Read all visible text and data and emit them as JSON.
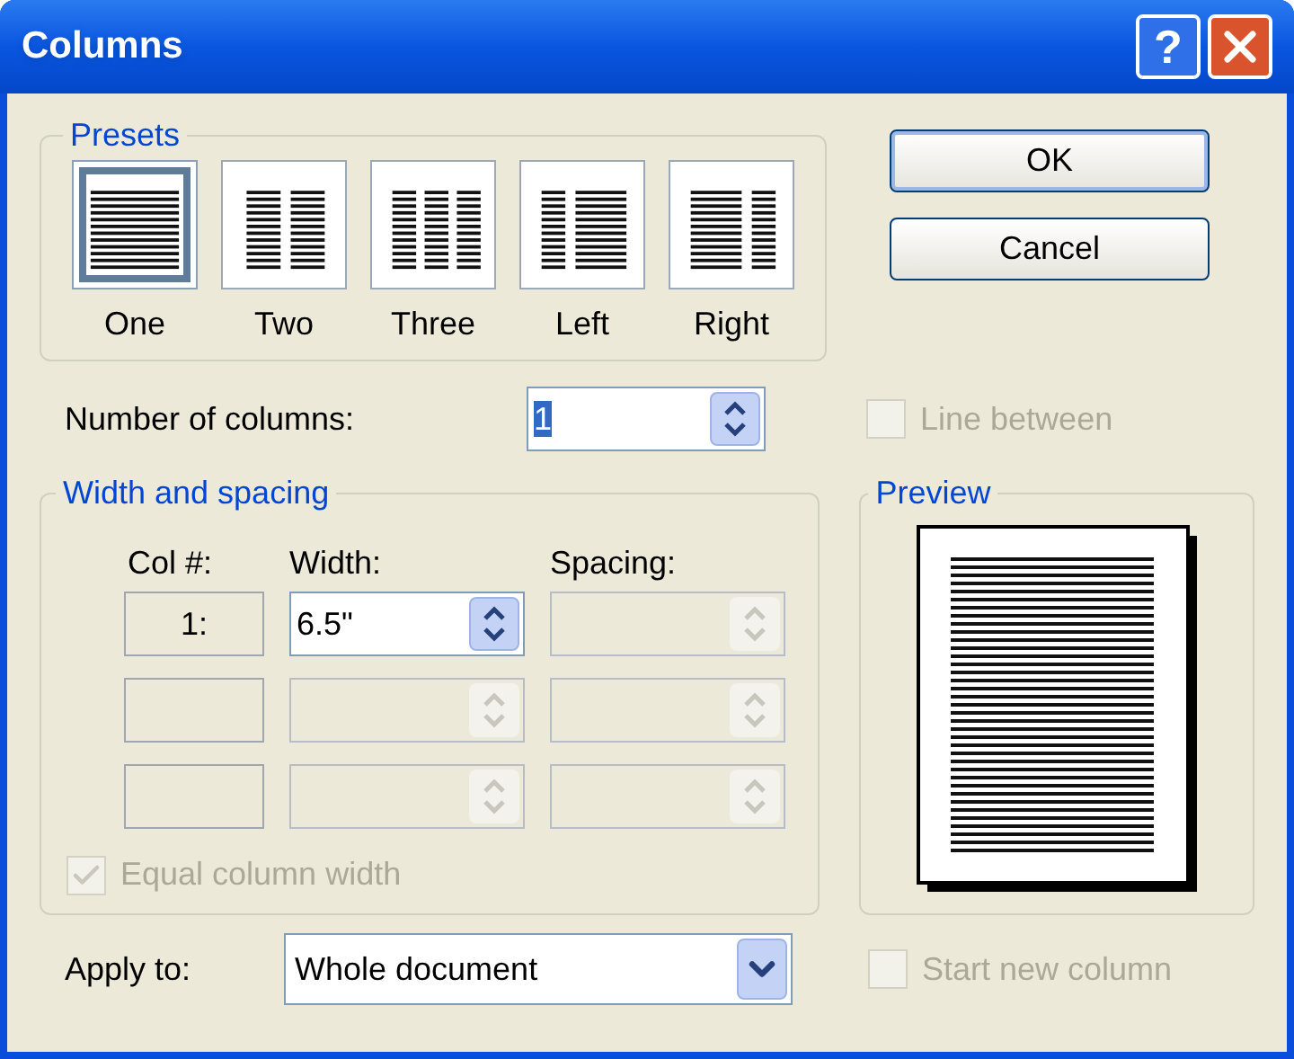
{
  "window": {
    "title": "Columns",
    "help": "?"
  },
  "presets": {
    "title": "Presets",
    "items": [
      {
        "label": "One",
        "kind": "one",
        "selected": true
      },
      {
        "label": "Two",
        "kind": "two",
        "selected": false
      },
      {
        "label": "Three",
        "kind": "three",
        "selected": false
      },
      {
        "label": "Left",
        "kind": "left",
        "selected": false
      },
      {
        "label": "Right",
        "kind": "right",
        "selected": false
      }
    ]
  },
  "buttons": [
    {
      "label": "OK",
      "default": true
    },
    {
      "label": "Cancel",
      "default": false
    }
  ],
  "number_of_columns": {
    "label": "Number of columns:",
    "value": "1",
    "selected": true
  },
  "line_between": {
    "label": "Line between",
    "checked": false,
    "disabled": true
  },
  "width_and_spacing": {
    "title": "Width and spacing",
    "headers": [
      "Col #:",
      "Width:",
      "Spacing:"
    ],
    "rows": [
      {
        "col": "1:",
        "width": "6.5\"",
        "width_disabled": false,
        "spacing_disabled": true
      },
      {
        "width_disabled": true,
        "spacing_disabled": true
      },
      {
        "width_disabled": true,
        "spacing_disabled": true
      }
    ]
  },
  "equal_column_width": {
    "label": "Equal column width",
    "checked": true,
    "disabled": true
  },
  "preview": {
    "title": "Preview"
  },
  "apply_to": {
    "label": "Apply to:",
    "value": "Whole document"
  },
  "start_new_column": {
    "label": "Start new column",
    "checked": false,
    "disabled": true
  }
}
